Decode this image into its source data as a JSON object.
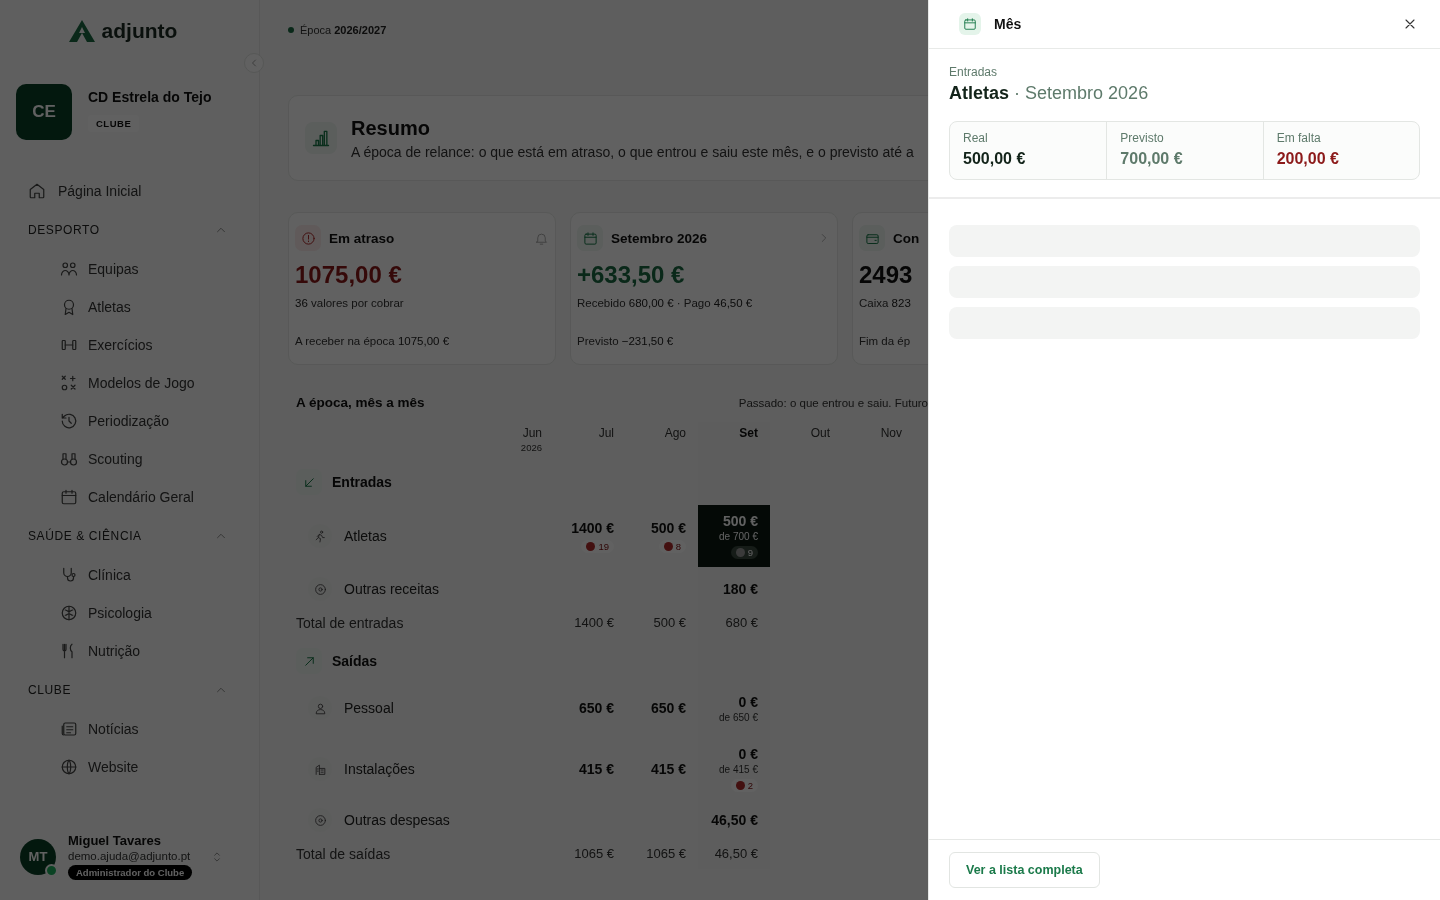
{
  "logo": "adjunto",
  "club": {
    "initials": "CE",
    "name": "CD Estrela do Tejo",
    "badge": "CLUBE"
  },
  "nav": {
    "home": {
      "label": "Página Inicial",
      "selected": false
    },
    "sections": [
      {
        "title": "DESPORTO",
        "expanded": true,
        "items": [
          {
            "label": "Equipas",
            "selected": false
          },
          {
            "label": "Atletas",
            "selected": false
          },
          {
            "label": "Exercícios",
            "selected": false
          },
          {
            "label": "Modelos de Jogo",
            "selected": false
          },
          {
            "label": "Periodização",
            "selected": false
          },
          {
            "label": "Scouting",
            "selected": false
          },
          {
            "label": "Calendário Geral",
            "selected": false
          }
        ]
      },
      {
        "title": "SAÚDE & CIÊNCIA",
        "expanded": true,
        "items": [
          {
            "label": "Clínica",
            "selected": false
          },
          {
            "label": "Psicologia",
            "selected": false
          },
          {
            "label": "Nutrição",
            "selected": false
          }
        ]
      },
      {
        "title": "CLUBE",
        "expanded": true,
        "items": [
          {
            "label": "Notícias",
            "selected": false
          },
          {
            "label": "Website",
            "selected": false
          }
        ]
      }
    ]
  },
  "user": {
    "initials": "MT",
    "name": "Miguel Tavares",
    "email": "demo.ajuda@adjunto.pt",
    "role": "Administrador do Clube",
    "online": true
  },
  "season": "Época **2026/2027**",
  "summary": {
    "title": "Resumo",
    "subtitle": "A época de relance: o que está em atraso, o que entrou e saiu este mês, e o previsto até a"
  },
  "cards": [
    {
      "kind": "overdue",
      "title": "Em atraso",
      "amount": "1075,00 €",
      "line1": "**36** valores por cobrar",
      "line2": "A receber na época **1075,00 €**"
    },
    {
      "kind": "month",
      "title": "Setembro 2026",
      "amount": "+633,50 €",
      "line1": "Recebido **680,00 €** · Pago **46,50 €**",
      "line2": "Previsto **−231,50 €**"
    },
    {
      "kind": "cash",
      "title": "Con",
      "amount": "2493",
      "line1": "Caixa **823**",
      "line2": "Fim da ép"
    }
  ],
  "table": {
    "title": "A época, mês a mês",
    "note": "Passado: o que entrou e saiu. Futuro",
    "columns": [
      {
        "label": "Jun",
        "sub": "2026",
        "current": false
      },
      {
        "label": "Jul",
        "current": false
      },
      {
        "label": "Ago",
        "current": false
      },
      {
        "label": "Set",
        "current": true
      },
      {
        "label": "Out",
        "current": false
      },
      {
        "label": "Nov",
        "current": false
      }
    ],
    "groups": [
      {
        "title": "Entradas",
        "rows": [
          {
            "label": "Atletas",
            "cells": [
              null,
              {
                "value": "1400 €",
                "badge": "19",
                "selected": false
              },
              {
                "value": "500 €",
                "badge": "8",
                "selected": false
              },
              {
                "value": "500 €",
                "sub": "de 700 €",
                "badge": "9",
                "selected": true
              },
              null,
              null
            ]
          },
          {
            "label": "Outras receitas",
            "cells": [
              null,
              null,
              null,
              {
                "value": "180 €",
                "selected": false
              },
              null,
              null
            ]
          }
        ],
        "total": {
          "label": "Total de entradas",
          "cells": [
            null,
            "1400 €",
            "500 €",
            "680 €",
            null,
            null
          ]
        }
      },
      {
        "title": "Saídas",
        "rows": [
          {
            "label": "Pessoal",
            "cells": [
              null,
              {
                "value": "650 €",
                "selected": false
              },
              {
                "value": "650 €",
                "selected": false
              },
              {
                "value": "0 €",
                "sub": "de 650 €",
                "selected": false
              },
              null,
              null
            ]
          },
          {
            "label": "Instalações",
            "cells": [
              null,
              {
                "value": "415 €",
                "selected": false
              },
              {
                "value": "415 €",
                "selected": false
              },
              {
                "value": "0 €",
                "sub": "de 415 €",
                "badge": "2",
                "selected": false
              },
              null,
              null
            ]
          },
          {
            "label": "Outras despesas",
            "cells": [
              null,
              null,
              null,
              {
                "value": "46,50 €",
                "selected": false
              },
              null,
              null
            ]
          }
        ],
        "total": {
          "label": "Total de saídas",
          "cells": [
            null,
            "1065 €",
            "1065 €",
            "46,50 €",
            null,
            null
          ]
        }
      }
    ]
  },
  "drawer": {
    "title": "Mês",
    "category": "Entradas",
    "heading": "Atletas",
    "separator": "·",
    "subheading": "Setembro 2026",
    "stats": [
      {
        "kind": "actual",
        "label": "Real",
        "value": "500,00 €"
      },
      {
        "kind": "planned",
        "label": "Previsto",
        "value": "700,00 €"
      },
      {
        "kind": "missing",
        "label": "Em falta",
        "value": "200,00 €"
      }
    ],
    "loading": true,
    "button": "Ver a lista completa"
  }
}
